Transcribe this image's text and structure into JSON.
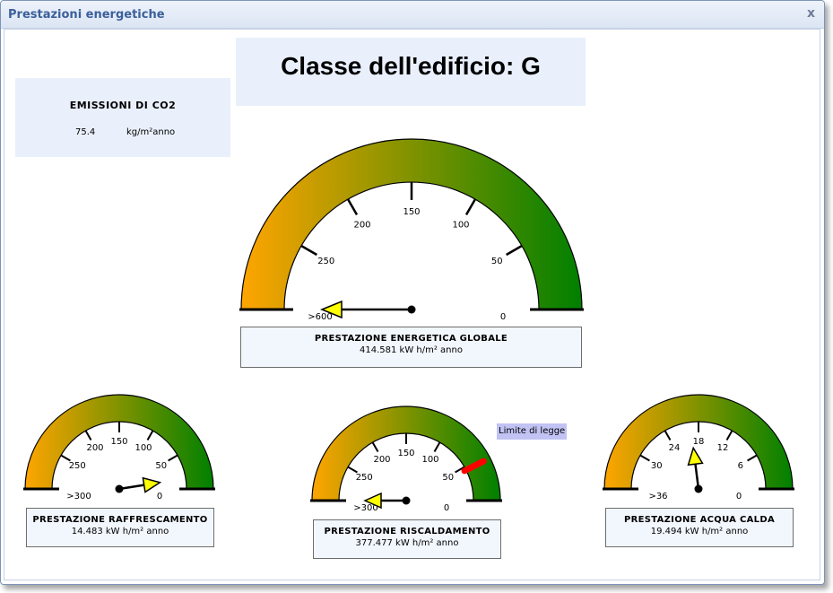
{
  "window": {
    "title": "Prestazioni energetiche",
    "close_glyph": "x"
  },
  "classe": {
    "label": "Classe dell'edificio: G"
  },
  "emissioni": {
    "title": "EMISSIONI DI CO2",
    "value": "75.4",
    "unit": "kg/m²anno"
  },
  "colors": {
    "gauge_start": "#ffa500",
    "gauge_end": "#008000",
    "needle_head": "#ffff00",
    "limit_marker": "#ff0000",
    "limit_bg": "#c2c2f4"
  },
  "gauges": {
    "globale": {
      "label": "PRESTAZIONE ENERGETICA GLOBALE",
      "value": "414.581 kW h/m² anno",
      "tick_labels": [
        ">600",
        "250",
        "200",
        "150",
        "100",
        "50",
        "0"
      ],
      "needle_fraction": 0.0
    },
    "raffrescamento": {
      "label": "PRESTAZIONE RAFFRESCAMENTO",
      "value": "14.483 kW h/m² anno",
      "tick_labels": [
        ">300",
        "250",
        "200",
        "150",
        "100",
        "50",
        "0"
      ],
      "needle_fraction": 0.95
    },
    "riscaldamento": {
      "label": "PRESTAZIONE RISCALDAMENTO",
      "value": "377.477 kW h/m² anno",
      "tick_labels": [
        ">300",
        "250",
        "200",
        "150",
        "100",
        "50",
        "0"
      ],
      "needle_fraction": 0.0,
      "limit_fraction": 0.85,
      "limit_label": "Limite di legge"
    },
    "acqua": {
      "label": "PRESTAZIONE ACQUA CALDA",
      "value": "19.494 kW h/m² anno",
      "tick_labels": [
        ">36",
        "30",
        "24",
        "18",
        "12",
        "6",
        "0"
      ],
      "needle_fraction": 0.46
    }
  }
}
